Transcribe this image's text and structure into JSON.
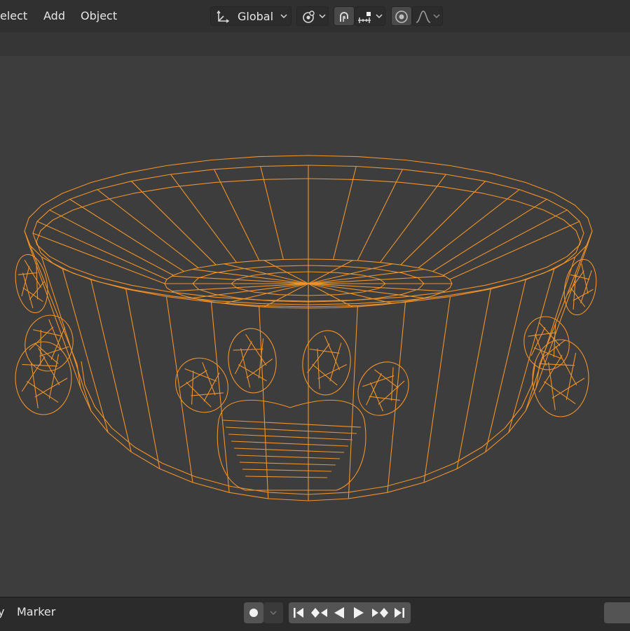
{
  "header": {
    "menu": {
      "select": "elect",
      "add": "Add",
      "object": "Object"
    },
    "transform_orientation": "Global",
    "icons": [
      "transform-orientation-icon",
      "pivot-point-icon",
      "snap-magnet-icon",
      "snap-increment-icon",
      "proportional-editing-icon",
      "falloff-curve-icon"
    ]
  },
  "timeline": {
    "menu_cut": "y",
    "marker": "Marker",
    "icons": [
      "record-icon",
      "jump-start-icon",
      "prev-keyframe-icon",
      "play-reverse-icon",
      "play-icon",
      "next-keyframe-icon",
      "jump-end-icon"
    ]
  },
  "viewport": {
    "background": "#3d3d3d",
    "wire_color": "#f0932a",
    "object": "dog-bowl-wireframe"
  }
}
